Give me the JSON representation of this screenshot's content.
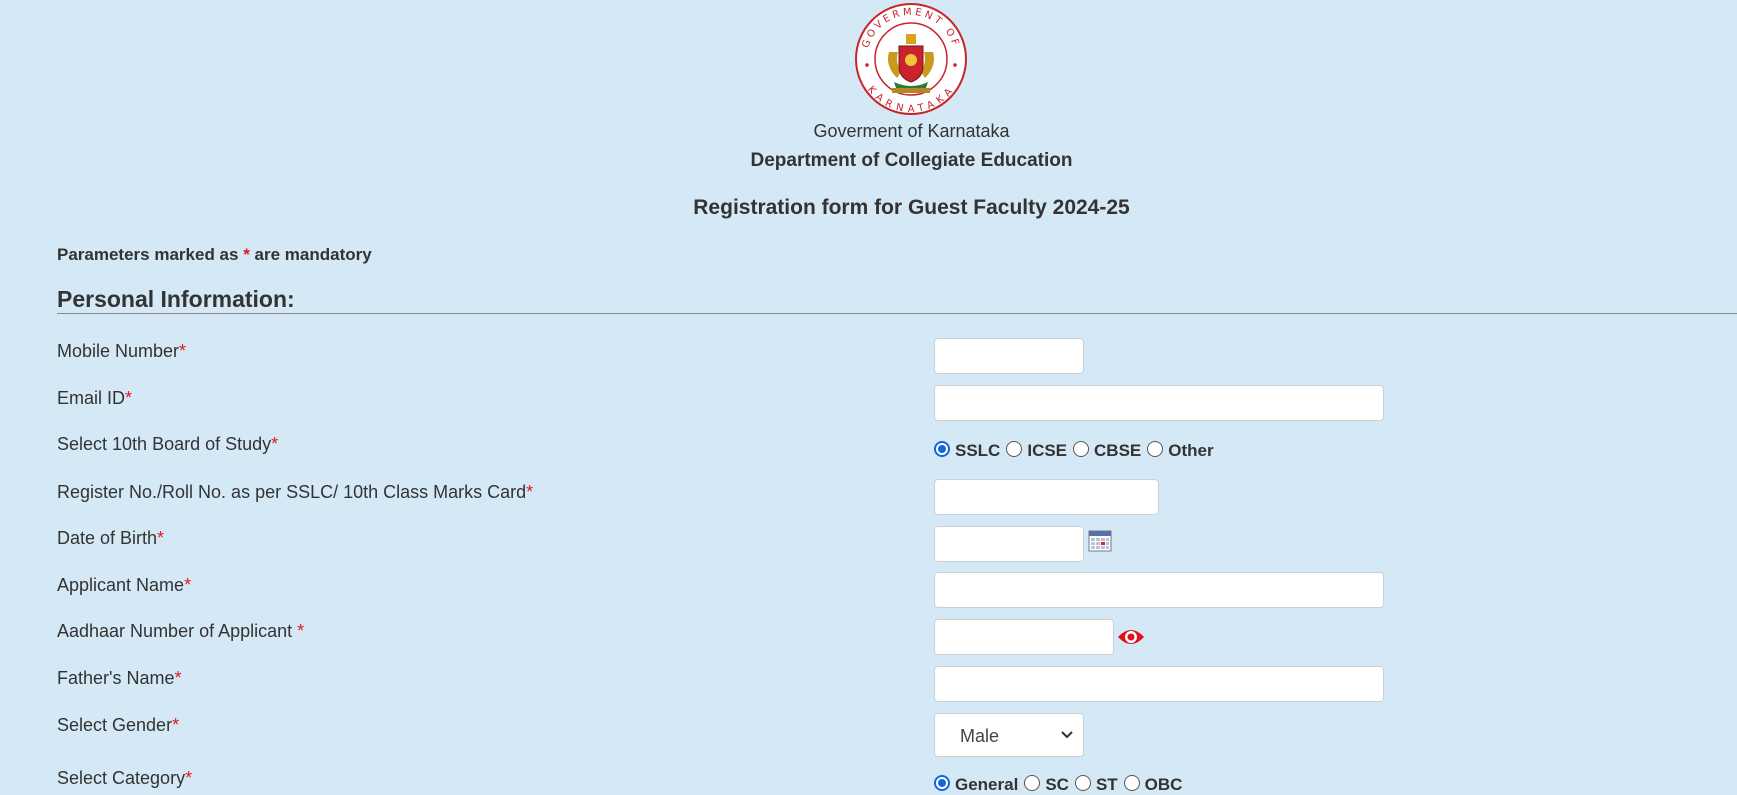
{
  "header": {
    "seal_text": "GOVERMENT OF KARNATAKA",
    "gov_name": "Goverment of Karnataka",
    "dept_name": "Department of Collegiate Education",
    "form_title": "Registration form for Guest Faculty 2024-25"
  },
  "notice": {
    "prefix": "Parameters marked as ",
    "star": "*",
    "suffix": " are mandatory"
  },
  "section_title": "Personal Information:",
  "fields": {
    "mobile": {
      "label": "Mobile Number",
      "star": "*",
      "value": ""
    },
    "email": {
      "label": "Email ID",
      "star": "*",
      "value": ""
    },
    "board": {
      "label": "Select 10th Board of Study",
      "star": "*",
      "options": [
        "SSLC",
        "ICSE",
        "CBSE",
        "Other"
      ],
      "selected": "SSLC"
    },
    "register_no": {
      "label": "Register No./Roll No. as per SSLC/ 10th Class Marks Card",
      "star": "*",
      "value": ""
    },
    "dob": {
      "label": "Date of Birth",
      "star": "*",
      "value": ""
    },
    "applicant_name": {
      "label": "Applicant Name",
      "star": "*",
      "value": ""
    },
    "aadhaar": {
      "label": "Aadhaar Number of Applicant ",
      "star": "*",
      "value": ""
    },
    "father_name": {
      "label": "Father's Name",
      "star": "*",
      "value": ""
    },
    "gender": {
      "label": "Select Gender",
      "star": "*",
      "selected": "Male"
    },
    "category": {
      "label": "Select Category",
      "star": "*",
      "options": [
        "General",
        "SC",
        "ST",
        "OBC"
      ],
      "selected": "General"
    }
  },
  "icons": {
    "calendar": "calendar-icon",
    "eye": "eye-icon",
    "chevron": "chevron-down-icon",
    "seal": "karnataka-seal-icon"
  },
  "colors": {
    "background": "#d4e9f5",
    "required_star": "#e01b1b",
    "radio_selected": "#1565d8",
    "eye_icon": "#e0101d",
    "seal_ring": "#c8242c"
  }
}
